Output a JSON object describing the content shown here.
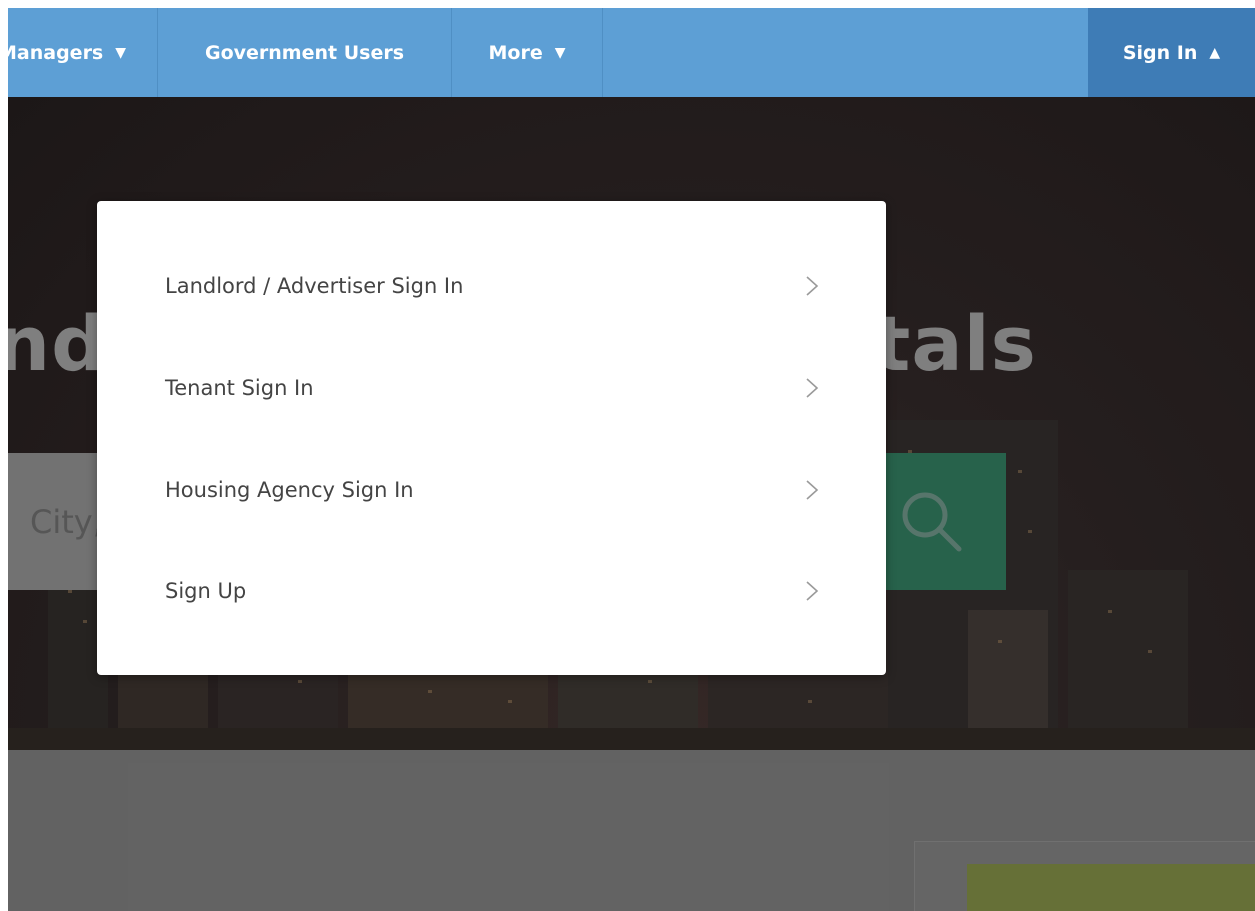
{
  "nav": {
    "items": [
      {
        "label": "Managers",
        "caret": "▼"
      },
      {
        "label": "Government Users"
      },
      {
        "label": "More",
        "caret": "▼"
      }
    ],
    "signin": {
      "label": "Sign In",
      "caret": "▲"
    }
  },
  "hero": {
    "title_left": "nd",
    "title_right": "tals",
    "search_placeholder": "City, "
  },
  "dropdown": {
    "items": [
      {
        "label": "Landlord / Advertiser Sign In"
      },
      {
        "label": "Tenant Sign In"
      },
      {
        "label": "Housing Agency Sign In"
      },
      {
        "label": "Sign Up"
      }
    ]
  },
  "colors": {
    "nav_bg": "#5d9fd5",
    "nav_active": "#3e7cb6",
    "search_button": "#2b6b52",
    "dropdown_bg": "#ffffff",
    "menu_text": "#444444"
  },
  "icons": {
    "search": "magnifier-icon",
    "chevron": "chevron-right-icon",
    "caret_down": "caret-down-icon",
    "caret_up": "caret-up-icon"
  }
}
